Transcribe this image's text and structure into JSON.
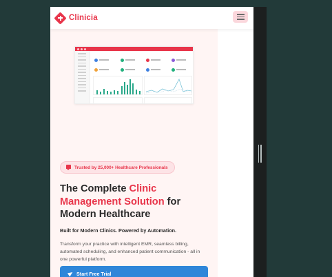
{
  "brand": {
    "name": "Clinicia",
    "accent": "#e8354a"
  },
  "hero": {
    "badge": "Trusted by 25,000+ Healthcare Professionals",
    "title_part1": "The Complete ",
    "title_accent": "Clinic Management Solution",
    "title_part2": " for Modern Healthcare",
    "tagline": "Built for Modern Clinics. Powered by Automation.",
    "description": "Transform your practice with intelligent EMR, seamless billing, automated scheduling, and enhanced patient communication - all in one powerful platform.",
    "cta_label": "Start Free Trial"
  },
  "colors": {
    "cta": "#2f86d9",
    "hero_bg": "#fff5f4",
    "page_bg": "#223a39"
  },
  "icons": [
    "clinicia-logo-icon",
    "hamburger-menu-icon",
    "shield-icon",
    "paper-plane-icon"
  ]
}
